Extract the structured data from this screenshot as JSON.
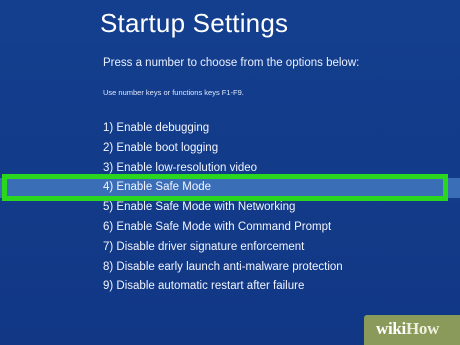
{
  "screen": {
    "title": "Startup Settings",
    "prompt": "Press a number to choose from the options below:",
    "hint": "Use number keys or functions keys F1-F9."
  },
  "options": [
    {
      "label": "1) Enable debugging",
      "selected": false
    },
    {
      "label": "2) Enable boot logging",
      "selected": false
    },
    {
      "label": "3) Enable low-resolution video",
      "selected": false
    },
    {
      "label": "4) Enable Safe Mode",
      "selected": true
    },
    {
      "label": "5) Enable Safe Mode with Networking",
      "selected": false
    },
    {
      "label": "6) Enable Safe Mode with Command Prompt",
      "selected": false
    },
    {
      "label": "7) Disable driver signature enforcement",
      "selected": false
    },
    {
      "label": "8) Disable early launch anti-malware protection",
      "selected": false
    },
    {
      "label": "9) Disable automatic restart after failure",
      "selected": false
    }
  ],
  "watermark": {
    "part1": "wiki",
    "part2": "How"
  },
  "colors": {
    "background": "#123d8c",
    "selected_row": "#3a6fb8",
    "highlight_frame": "#2bd61f",
    "watermark_bg": "#8a9a5b"
  }
}
